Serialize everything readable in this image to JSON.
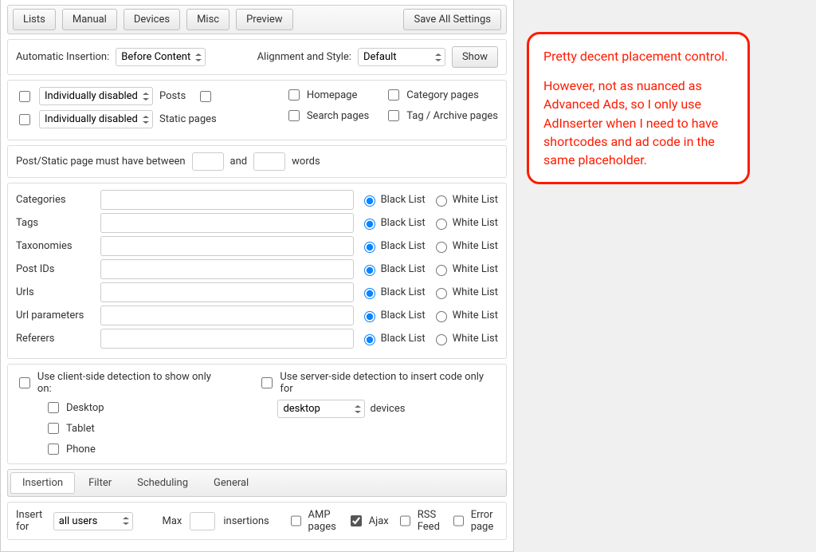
{
  "topbar": {
    "lists": "Lists",
    "manual": "Manual",
    "devices": "Devices",
    "misc": "Misc",
    "preview": "Preview",
    "save_all": "Save All Settings"
  },
  "auto": {
    "label": "Automatic Insertion:",
    "value": "Before Content",
    "align_label": "Alignment and Style:",
    "align_value": "Default",
    "show_btn": "Show"
  },
  "pages": {
    "left1_sel": "Individually disabled",
    "left1_label": "Posts",
    "left2_sel": "Individually disabled",
    "left2_label": "Static pages",
    "homepage": "Homepage",
    "category": "Category pages",
    "search": "Search pages",
    "tag": "Tag / Archive pages"
  },
  "wordcount": {
    "prefix": "Post/Static page must have between",
    "mid": "and",
    "suffix": "words"
  },
  "filters": [
    {
      "label": "Categories"
    },
    {
      "label": "Tags"
    },
    {
      "label": "Taxonomies"
    },
    {
      "label": "Post IDs"
    },
    {
      "label": "Urls"
    },
    {
      "label": "Url parameters"
    },
    {
      "label": "Referers"
    }
  ],
  "filter_labels": {
    "black": "Black List",
    "white": "White List"
  },
  "detect": {
    "client": "Use client-side detection to show only on:",
    "desktop": "Desktop",
    "tablet": "Tablet",
    "phone": "Phone",
    "server": "Use server-side detection to insert code only for",
    "server_sel": "desktop",
    "server_suffix": "devices"
  },
  "tabs": {
    "insertion": "Insertion",
    "filter": "Filter",
    "scheduling": "Scheduling",
    "general": "General"
  },
  "insertion": {
    "insert_for": "Insert for",
    "insert_for_val": "all users",
    "max": "Max",
    "insertions": "insertions",
    "amp": "AMP pages",
    "ajax": "Ajax",
    "rss": "RSS Feed",
    "error": "Error page"
  },
  "callout": {
    "p1": "Pretty decent placement control.",
    "p2": "However, not as nuanced as Advanced Ads, so I only use AdInserter when I need to have shortcodes and ad code in the same placeholder."
  }
}
